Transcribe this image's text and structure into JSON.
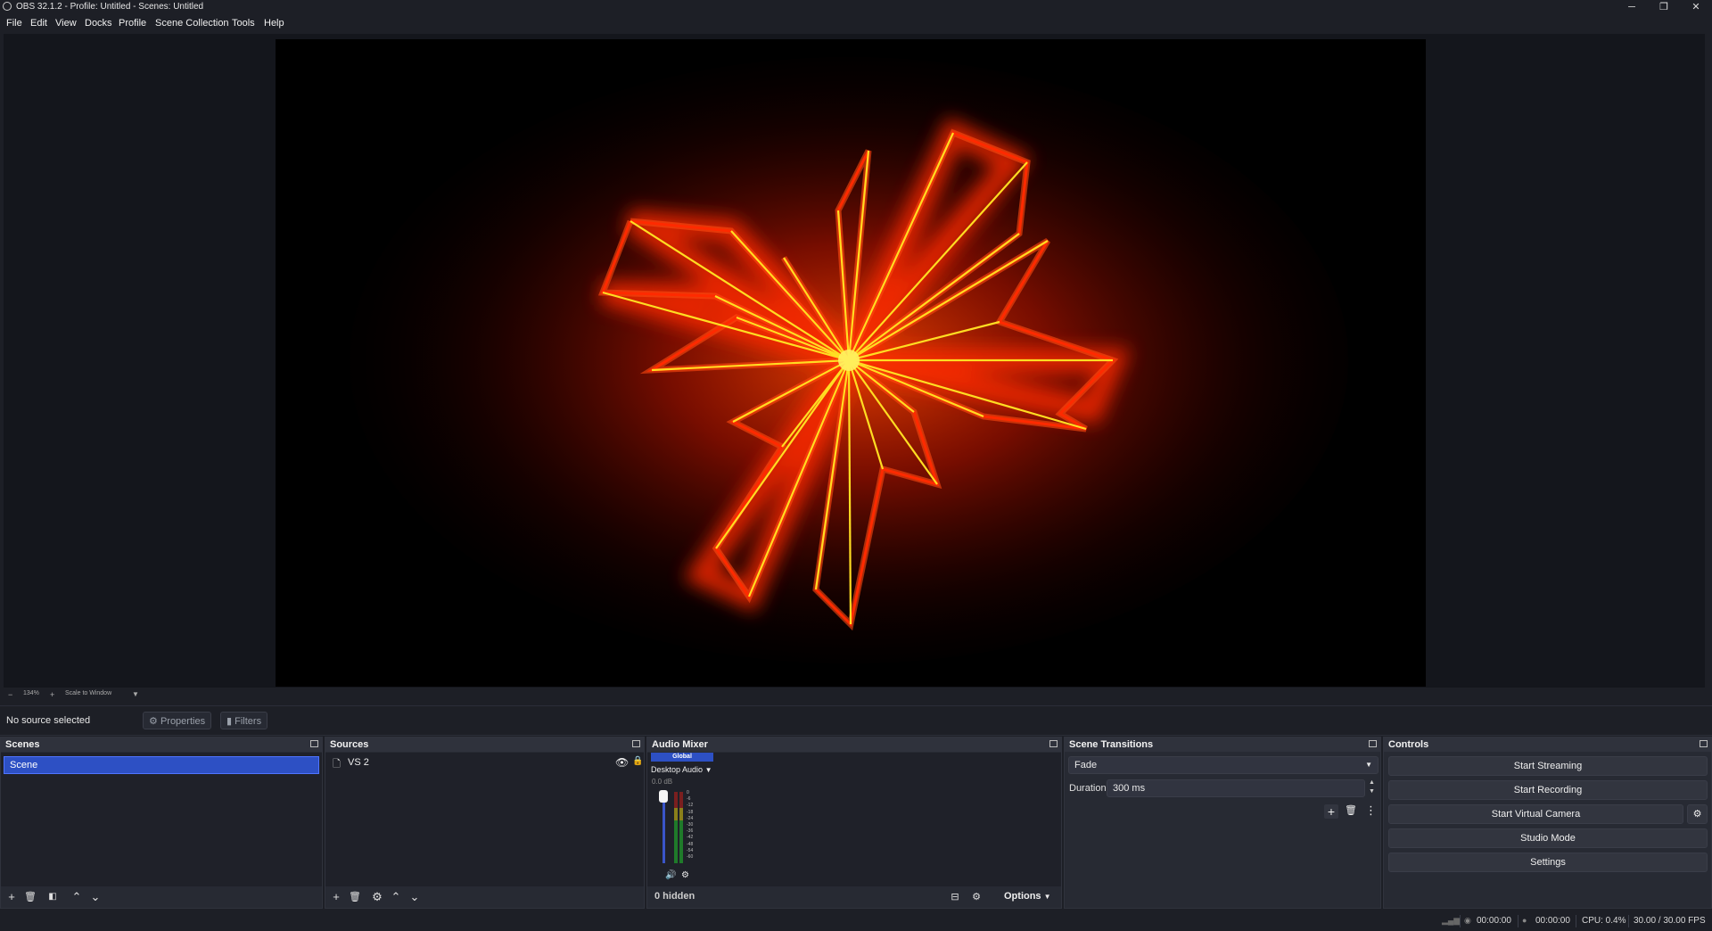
{
  "window": {
    "title": "OBS 32.1.2 - Profile: Untitled - Scenes: Untitled",
    "minimize_glyph": "─",
    "maximize_glyph": "❐",
    "close_glyph": "✕"
  },
  "menu": {
    "items": [
      "File",
      "Edit",
      "View",
      "Docks",
      "Profile",
      "Scene Collection",
      "Tools",
      "Help"
    ]
  },
  "preview": {
    "zoom_out": "−",
    "zoom_level": "134%",
    "zoom_in": "+",
    "scale_mode": "Scale to Window"
  },
  "source_toolbar": {
    "status": "No source selected",
    "properties_label": "Properties",
    "filters_label": "Filters"
  },
  "scenes": {
    "title": "Scenes",
    "items": [
      "Scene"
    ]
  },
  "sources": {
    "title": "Sources",
    "items": [
      {
        "name": "VS 2"
      }
    ]
  },
  "audio_mixer": {
    "title": "Audio Mixer",
    "tab": "Global",
    "channel_name": "Desktop Audio",
    "volume": "0.0 dB",
    "scale": [
      "0",
      "-6",
      "-12",
      "-18",
      "-24",
      "-30",
      "-36",
      "-42",
      "-48",
      "-54",
      "-60"
    ],
    "hidden_label": "0 hidden",
    "options_label": "Options"
  },
  "transitions": {
    "title": "Scene Transitions",
    "selected": "Fade",
    "duration_label": "Duration",
    "duration_value": "300 ms"
  },
  "controls": {
    "title": "Controls",
    "start_streaming": "Start Streaming",
    "start_recording": "Start Recording",
    "start_virtual_camera": "Start Virtual Camera",
    "studio_mode": "Studio Mode",
    "settings": "Settings"
  },
  "status": {
    "stream_time": "00:00:00",
    "record_time": "00:00:00",
    "cpu": "CPU: 0.4%",
    "fps": "30.00 / 30.00 FPS"
  },
  "colors": {
    "accent": "#2d50c4",
    "ray": "#ffd21a",
    "glow": "#ff2a00"
  }
}
